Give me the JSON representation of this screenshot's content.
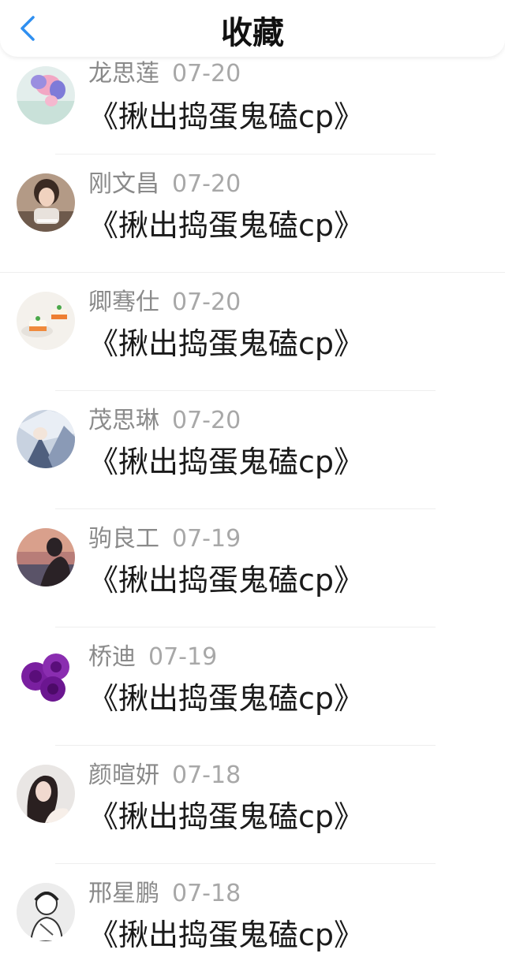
{
  "header": {
    "title": "收藏",
    "back_icon": "chevron-left-icon",
    "back_color": "#2f8ff0"
  },
  "items": [
    {
      "name": "龙思莲",
      "date": "07-20",
      "title": "《揪出捣蛋鬼磕cp》",
      "avatar": "balloon-avatar"
    },
    {
      "name": "刚文昌",
      "date": "07-20",
      "title": "《揪出捣蛋鬼磕cp》",
      "avatar": "girl-photo-avatar"
    },
    {
      "name": "卿骞仕",
      "date": "07-20",
      "title": "《揪出捣蛋鬼磕cp》",
      "avatar": "dessert-avatar"
    },
    {
      "name": "茂思琳",
      "date": "07-20",
      "title": "《揪出捣蛋鬼磕cp》",
      "avatar": "anime-illustration-avatar"
    },
    {
      "name": "驹良工",
      "date": "07-19",
      "title": "《揪出捣蛋鬼磕cp》",
      "avatar": "sunset-silhouette-avatar"
    },
    {
      "name": "桥迪",
      "date": "07-19",
      "title": "《揪出捣蛋鬼磕cp》",
      "avatar": "purple-roses-avatar"
    },
    {
      "name": "颜暄妍",
      "date": "07-18",
      "title": "《揪出捣蛋鬼磕cp》",
      "avatar": "woman-portrait-avatar"
    },
    {
      "name": "邢星鹏",
      "date": "07-18",
      "title": "《揪出捣蛋鬼磕cp》",
      "avatar": "sketch-character-avatar"
    }
  ]
}
